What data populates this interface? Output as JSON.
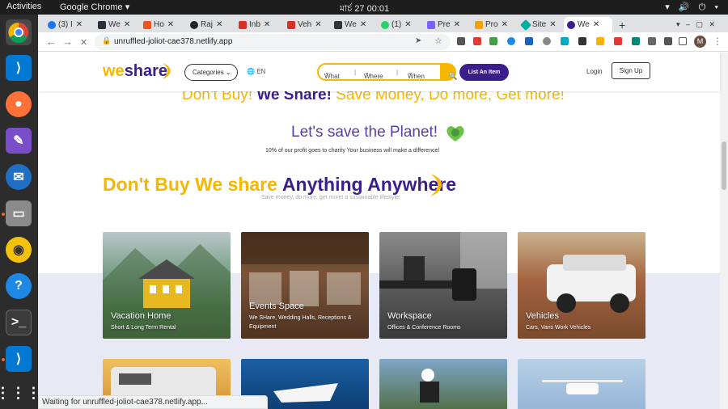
{
  "os": {
    "activities": "Activities",
    "app_name": "Google Chrome ▾",
    "clock": "মার্চ 27  00:01",
    "tray": "▾ 🔊 ⏻ ▾"
  },
  "browser": {
    "tabs": [
      {
        "label": "(3) I",
        "color": "#1877f2"
      },
      {
        "label": "We",
        "color": "#2a2f3a"
      },
      {
        "label": "Ho",
        "color": "#e95420"
      },
      {
        "label": "Raj",
        "color": "#222222"
      },
      {
        "label": "Inb",
        "color": "#d93025"
      },
      {
        "label": "Veh",
        "color": "#d93025"
      },
      {
        "label": "We",
        "color": "#333333"
      },
      {
        "label": "(1)",
        "color": "#25d366"
      },
      {
        "label": "Pre",
        "color": "#7b61ff"
      },
      {
        "label": "Pro",
        "color": "#f4a300"
      },
      {
        "label": "Site",
        "color": "#00ad9f"
      },
      {
        "label": "We",
        "color": "#3a1e8c"
      }
    ],
    "new_tab": "+",
    "url": "unruffled-joliot-cae378.netlify.app",
    "avatar_letter": "M",
    "status_text": "Waiting for unruffled-joliot-cae378.netlify.app..."
  },
  "site": {
    "logo_we": "we",
    "logo_share": "share",
    "categories_label": "Categories",
    "lang_label": "EN",
    "search_what": "What",
    "search_where": "Where",
    "search_when": "When",
    "list_item_label": "List An Item",
    "login_label": "Login",
    "signup_label": "Sign Up",
    "hero_cut_yellow": "Don't Buy!",
    "hero_cut_purple": "We Share!",
    "hero_cut_rest": "Save Money, Do more, Get more!",
    "planet_text": "Let's save the Planet!",
    "charity_text": "10% of our profit goes to charity Your business will make a difference!",
    "section_title_yellow": "Don't Buy We share",
    "section_title_purple": "Anything Anywhere",
    "section_sub": "Save money, do more, get more! a sustainable lifestyle!",
    "cards": [
      {
        "title": "Vacation Home",
        "sub": "Short & Long Term Rental"
      },
      {
        "title": "Events Space",
        "sub": "We SHare, Wedding Halls, Receptions & Equipment"
      },
      {
        "title": "Workspace",
        "sub": "Offices & Conference Rooms"
      },
      {
        "title": "Vehicles",
        "sub": "Cars, Vans Work Vehicles"
      }
    ]
  },
  "colors": {
    "brand_yellow": "#f5b700",
    "brand_purple": "#3a1e8c"
  }
}
